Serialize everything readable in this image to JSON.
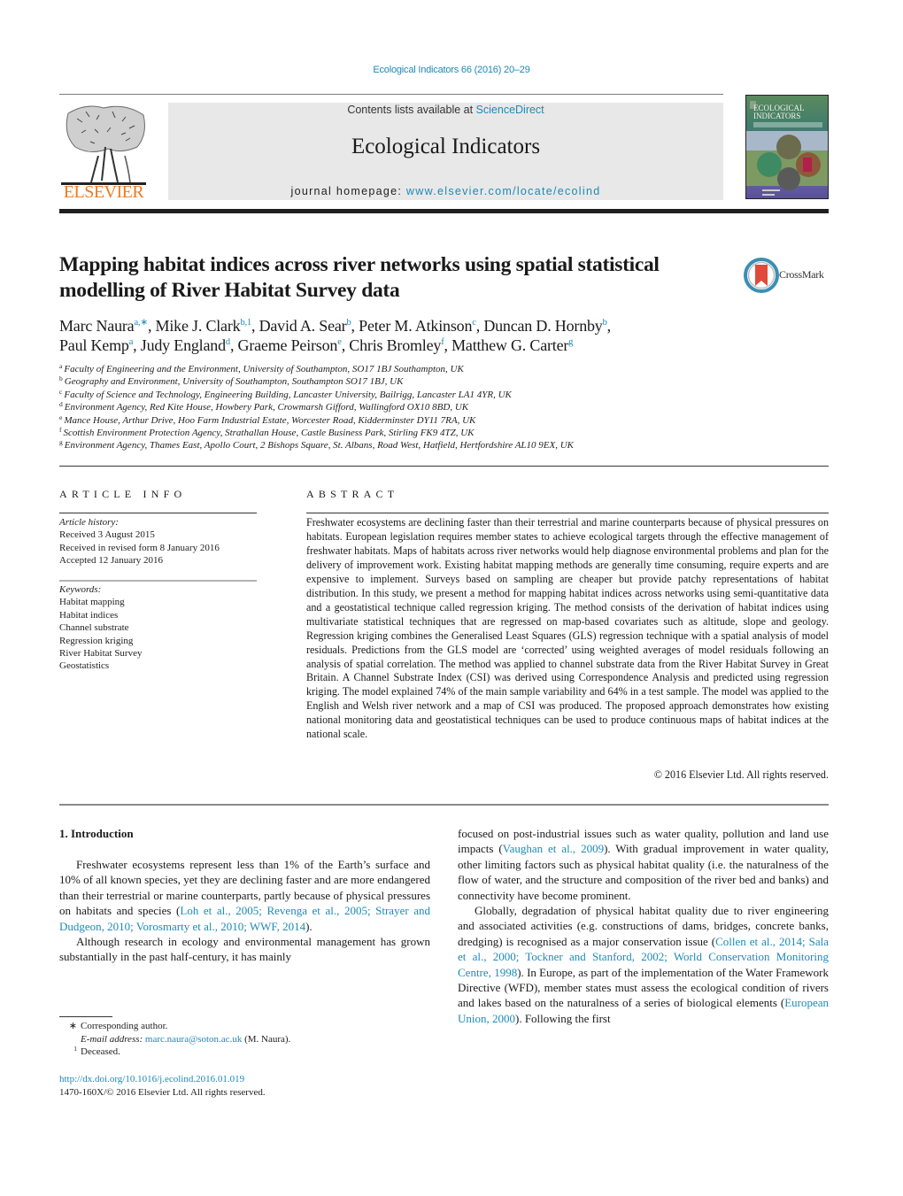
{
  "running_header": "Ecological Indicators 66 (2016) 20–29",
  "masthead": {
    "publisher_logo_text": "ELSEVIER",
    "contents_prefix": "Contents lists available at ",
    "contents_link": "ScienceDirect",
    "journal_title": "Ecological Indicators",
    "homepage_prefix": "journal homepage: ",
    "homepage_link": "www.elsevier.com/locate/ecolind",
    "cover_title_line1": "ECOLOGICAL",
    "cover_title_line2": "INDICATORS",
    "colors": {
      "link": "#1d8ab6",
      "elsevier_orange": "#f07a1c"
    }
  },
  "article": {
    "title": "Mapping habitat indices across river networks using spatial statistical modelling of River Habitat Survey data",
    "crossmark_label": "CrossMark",
    "authors": [
      {
        "name": "Marc Naura",
        "sup": "a,∗",
        "sep": ", "
      },
      {
        "name": "Mike J. Clark",
        "sup": "b,1",
        "sep": ", "
      },
      {
        "name": "David A. Sear",
        "sup": "b",
        "sep": ", "
      },
      {
        "name": "Peter M. Atkinson",
        "sup": "c",
        "sep": ", "
      },
      {
        "name": "Duncan D. Hornby",
        "sup": "b",
        "sep": ","
      },
      {
        "name": "Paul Kemp",
        "sup": "a",
        "sep": ", "
      },
      {
        "name": "Judy England",
        "sup": "d",
        "sep": ", "
      },
      {
        "name": "Graeme Peirson",
        "sup": "e",
        "sep": ", "
      },
      {
        "name": "Chris Bromley",
        "sup": "f",
        "sep": ", "
      },
      {
        "name": "Matthew G. Carter",
        "sup": "g",
        "sep": ""
      }
    ],
    "affiliations": [
      {
        "key": "a",
        "text": "Faculty of Engineering and the Environment, University of Southampton, SO17 1BJ Southampton, UK"
      },
      {
        "key": "b",
        "text": "Geography and Environment, University of Southampton, Southampton SO17 1BJ, UK"
      },
      {
        "key": "c",
        "text": "Faculty of Science and Technology, Engineering Building, Lancaster University, Bailrigg, Lancaster LA1 4YR, UK"
      },
      {
        "key": "d",
        "text": "Environment Agency, Red Kite House, Howbery Park, Crowmarsh Gifford, Wallingford OX10 8BD, UK"
      },
      {
        "key": "e",
        "text": "Mance House, Arthur Drive, Hoo Farm Industrial Estate, Worcester Road, Kidderminster DY11 7RA, UK"
      },
      {
        "key": "f",
        "text": "Scottish Environment Protection Agency, Strathallan House, Castle Business Park, Stirling FK9 4TZ, UK"
      },
      {
        "key": "g",
        "text": "Environment Agency, Thames East, Apollo Court, 2 Bishops Square, St. Albans, Road West, Hatfield, Hertfordshire AL10 9EX, UK"
      }
    ]
  },
  "article_info": {
    "label": "ARTICLE INFO",
    "history_label": "Article history:",
    "history": [
      "Received 3 August 2015",
      "Received in revised form 8 January 2016",
      "Accepted 12 January 2016"
    ],
    "keywords_label": "Keywords:",
    "keywords": [
      "Habitat mapping",
      "Habitat indices",
      "Channel substrate",
      "Regression kriging",
      "River Habitat Survey",
      "Geostatistics"
    ]
  },
  "abstract": {
    "label": "ABSTRACT",
    "text": "Freshwater ecosystems are declining faster than their terrestrial and marine counterparts because of physical pressures on habitats. European legislation requires member states to achieve ecological targets through the effective management of freshwater habitats. Maps of habitats across river networks would help diagnose environmental problems and plan for the delivery of improvement work. Existing habitat mapping methods are generally time consuming, require experts and are expensive to implement. Sur­veys based on sampling are cheaper but provide patchy representations of habitat distribution. In this study, we present a method for mapping habitat indices across networks using semi-quantitative data and a geostatistical technique called regression kriging. The method consists of the derivation of habi­tat indices using multivariate statistical techniques that are regressed on map-based covariates such as altitude, slope and geology. Regression kriging combines the Generalised Least Squares (GLS) regression technique with a spatial analysis of model residuals. Predictions from the GLS model are ‘corrected’ using weighted averages of model residuals following an analysis of spatial correlation. The method was applied to channel substrate data from the River Habitat Survey in Great Britain. A Channel Substrate Index (CSI) was derived using Correspondence Analysis and predicted using regression kriging. The model explained 74% of the main sample variability and 64% in a test sample. The model was applied to the English and Welsh river network and a map of CSI was produced. The proposed approach demonstrates how exist­ing national monitoring data and geostatistical techniques can be used to produce continuous maps of habitat indices at the national scale.",
    "copyright": "© 2016 Elsevier Ltd. All rights reserved."
  },
  "body": {
    "section_heading": "1.  Introduction",
    "left": {
      "p1_text": "Freshwater ecosystems represent less than 1% of the Earth’s sur­face and 10% of all known species, yet they are declining faster and are more endangered than their terrestrial or marine counter­parts, partly because of physical pressures on habitats and species (",
      "p1_cites": "Loh et al., 2005; Revenga et al., 2005; Strayer and Dudgeon, 2010; Vorosmarty et al., 2010; WWF, 2014",
      "p1_end": ").",
      "p2_text": "Although research in ecology and environmental management has grown substantially in the past half-century, it has mainly"
    },
    "right": {
      "p1_text": "focused on post-industrial issues such as water quality, pollution and land use impacts (",
      "p1_cite": "Vaughan et al., 2009",
      "p1_end": "). With gradual improve­ment in water quality, other limiting factors such as physical habitat quality (i.e. the naturalness of the flow of water, and the structure and composition of the river bed and banks) and connectivity have become prominent.",
      "p2_text": "Globally, degradation of physical habitat quality due to river engineering and associated activities (e.g. constructions of dams, bridges, concrete banks, dredging) is recognised as a major con­servation issue (",
      "p2_cites": "Collen et al., 2014; Sala et al., 2000; Tockner and Stanford, 2002; World Conservation Monitoring Centre, 1998",
      "p2_mid": "). In Europe, as part of the implementation of the Water Framework Directive (WFD), member states must assess the ecological con­dition of rivers and lakes based on the naturalness of a series of biological elements (",
      "p2_cite2": "European Union, 2000",
      "p2_end": "). Following the first"
    }
  },
  "footnotes": {
    "corresponding_mark": "∗",
    "corresponding": "Corresponding author.",
    "email_label": "E-mail address: ",
    "email": "marc.naura@soton.ac.uk",
    "email_suffix": " (M. Naura).",
    "deceased_mark": "1",
    "deceased": "Deceased.",
    "doi": "http://dx.doi.org/10.1016/j.ecolind.2016.01.019",
    "issn_line": "1470-160X/© 2016 Elsevier Ltd. All rights reserved."
  }
}
